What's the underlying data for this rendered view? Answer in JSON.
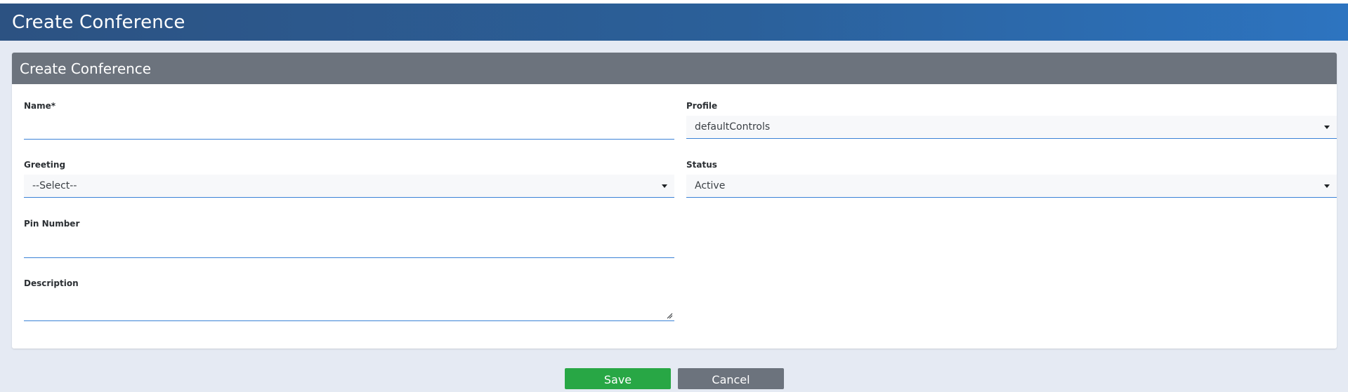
{
  "header": {
    "title": "Create Conference"
  },
  "card": {
    "title": "Create Conference"
  },
  "form": {
    "name": {
      "label": "Name*",
      "value": ""
    },
    "profile": {
      "label": "Profile",
      "selected": "defaultControls"
    },
    "greeting": {
      "label": "Greeting",
      "selected": "--Select--"
    },
    "status": {
      "label": "Status",
      "selected": "Active"
    },
    "pin_number": {
      "label": "Pin Number",
      "value": ""
    },
    "description": {
      "label": "Description",
      "value": ""
    }
  },
  "actions": {
    "save_label": "Save",
    "cancel_label": "Cancel"
  },
  "colors": {
    "header_gradient_start": "#2c5282",
    "header_gradient_end": "#2d74c0",
    "card_header": "#6c737d",
    "page_background": "#e5eaf3",
    "input_underline": "#3b82d6",
    "save_button": "#28a745",
    "cancel_button": "#6c737d"
  },
  "icons": {
    "select_caret": "chevron-down-icon",
    "textarea_resize": "resize-handle-icon"
  }
}
